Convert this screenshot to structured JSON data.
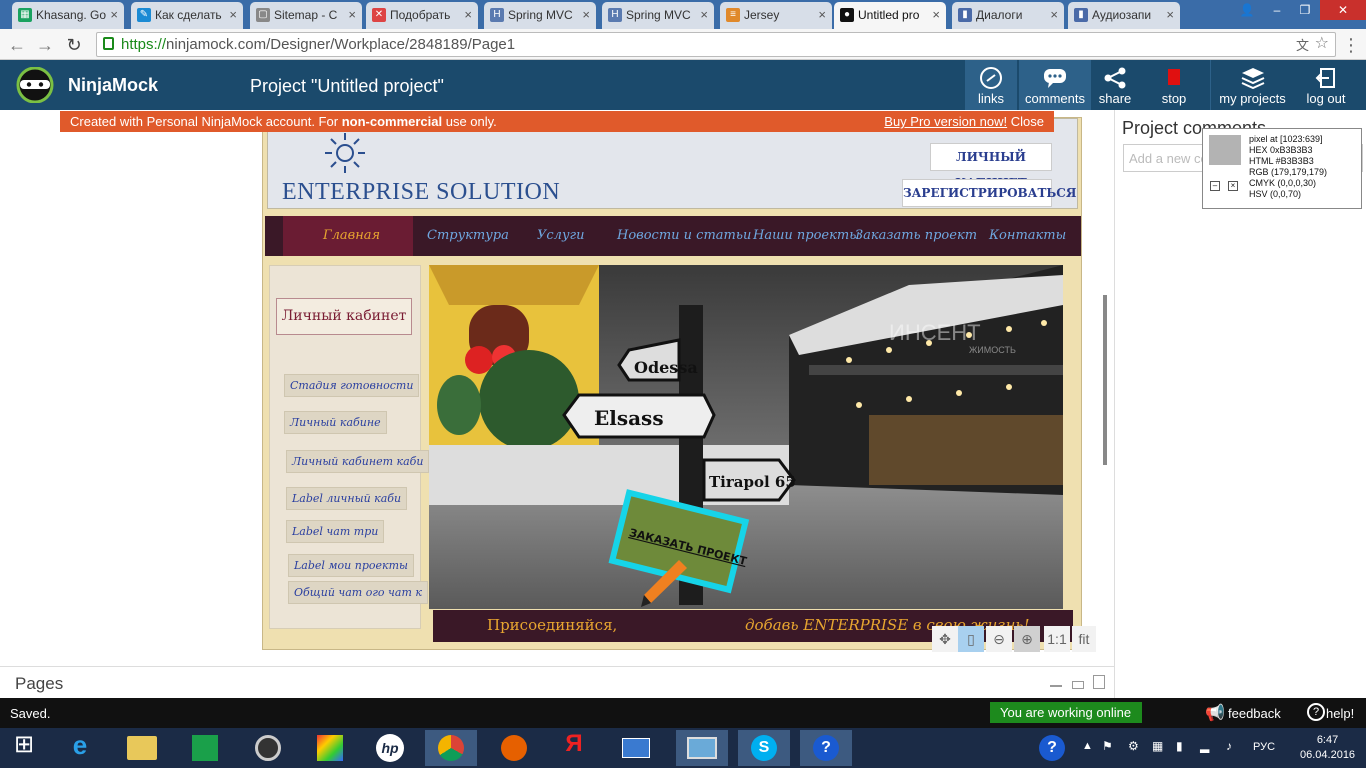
{
  "browser": {
    "tabs": [
      {
        "label": "Khasang. Go",
        "color": "#1aa260",
        "glyph": "▦"
      },
      {
        "label": "Как сделать",
        "color": "#1a8ad4",
        "glyph": "✎"
      },
      {
        "label": "Sitemap - C",
        "color": "#888888",
        "glyph": "▢"
      },
      {
        "label": "Подобрать",
        "color": "#d44",
        "glyph": "✕"
      },
      {
        "label": "Spring MVC",
        "color": "#5a7ab0",
        "glyph": "H"
      },
      {
        "label": "Spring MVC",
        "color": "#5a7ab0",
        "glyph": "H"
      },
      {
        "label": "Jersey",
        "color": "#e0892b",
        "glyph": "≡"
      },
      {
        "label": "Untitled pro",
        "color": "#111111",
        "glyph": "●"
      },
      {
        "label": "Диалоги",
        "color": "#4a6aa8",
        "glyph": "▮"
      },
      {
        "label": "Аудиозапи",
        "color": "#4a6aa8",
        "glyph": "▮"
      }
    ],
    "url_scheme": "https://",
    "url_rest": "ninjamock.com/Designer/Workplace/2848189/Page1"
  },
  "header": {
    "brand": "NinjaMock",
    "project_title": "Project \"Untitled project\"",
    "buttons": [
      {
        "label": "links",
        "icon": "link-icon"
      },
      {
        "label": "comments",
        "icon": "comments-icon"
      },
      {
        "label": "share",
        "icon": "share-icon"
      },
      {
        "label": "stop",
        "icon": "stop-icon"
      },
      {
        "label": "my projects",
        "icon": "layers-icon"
      },
      {
        "label": "log out",
        "icon": "logout-icon"
      }
    ]
  },
  "notice": {
    "text_before": "Created with Personal NinjaMock account. For ",
    "text_bold": "non-commercial",
    "text_after": " use only.",
    "buy_link": "Buy Pro version now!",
    "close": "Close"
  },
  "right_pane": {
    "title": "Project comments",
    "input_placeholder": "Add a new comment",
    "pixel_info": {
      "line1": "pixel at [1023:639]",
      "line2": "HEX 0xB3B3B3",
      "line3": "HTML #B3B3B3",
      "line4": "RGB (179,179,179)",
      "line5": "CMYK (0,0,0,30)",
      "line6": "HSV (0,0,70)",
      "swatch": "#b3b3b3"
    }
  },
  "mockup": {
    "logo_text": "ENTERPRISE SOLUTION",
    "btn_cabinet": "ЛИЧНЫЙ КАБИНЕТ",
    "btn_register": "ЗАРЕГИСТРИРОВАТЬСЯ",
    "nav": [
      "Главная",
      "Структура",
      "Услуги",
      "Новости и статьи",
      "Наши проекты",
      "Заказать проект",
      "Контакты"
    ],
    "side_title": "Личный кабинет",
    "side_items": [
      "Стадия готовности",
      "Личный кабине",
      "Личный кабинет каби",
      "Label личный каби",
      "Label чат три",
      "Label мои проекты",
      "Общий чат ого чат к"
    ],
    "hero_sign": "ЗАКАЗАТЬ ПРОЕКТ",
    "hero_watermark": "ИНСЕНТ",
    "hero_watermark_sub": "ЖИМОСТЬ",
    "signposts": [
      "Odessa",
      "Elsass",
      "Tirapol 65"
    ],
    "bar_left": "Присоединяйся,",
    "bar_right": "добавь ENTERPRISE в свою жизнь!"
  },
  "zoom": {
    "one_to_one": "1:1",
    "fit": "fit"
  },
  "pages_label": "Pages",
  "status": {
    "saved": "Saved.",
    "online": "You are working online",
    "feedback": "feedback",
    "help": "help!"
  },
  "taskbar": {
    "lang": "РУС",
    "time": "6:47",
    "date": "06.04.2016"
  }
}
